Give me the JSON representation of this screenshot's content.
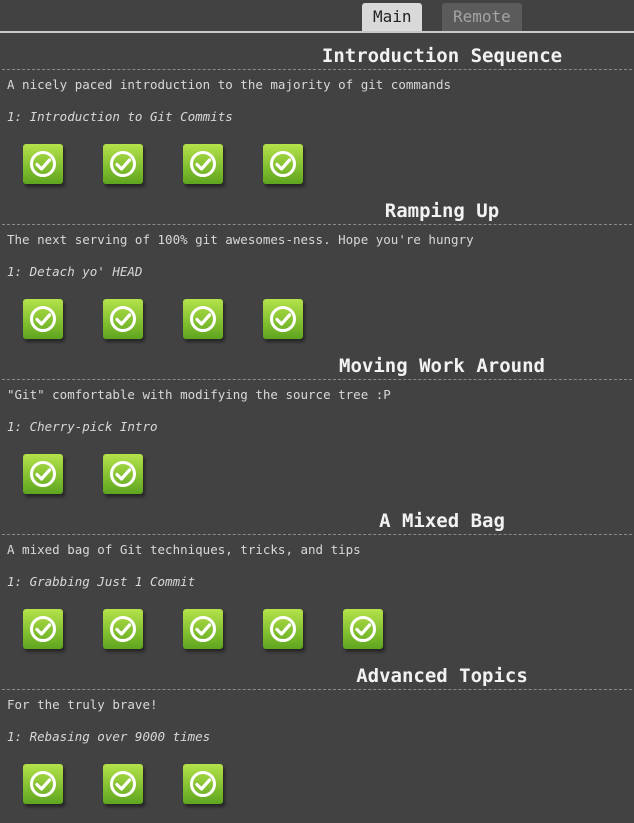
{
  "tabs": [
    {
      "label": "Main",
      "selected": true
    },
    {
      "label": "Remote",
      "selected": false
    }
  ],
  "colors": {
    "background": "#424242",
    "completed_level": "#7ec22e",
    "tab_selected_bg": "#d9d9d9",
    "tab_unselected_bg": "#5b5b5b"
  },
  "sequences": [
    {
      "title": "Introduction Sequence",
      "about": "A nicely paced introduction to the majority of git commands",
      "current_level": "1: Introduction to Git Commits",
      "level_count": 4,
      "completed_icon": "check-circle-icon"
    },
    {
      "title": "Ramping Up",
      "about": "The next serving of 100% git awesomes-ness. Hope you're hungry",
      "current_level": "1: Detach yo' HEAD",
      "level_count": 4,
      "completed_icon": "check-circle-icon"
    },
    {
      "title": "Moving Work Around",
      "about": "\"Git\" comfortable with modifying the source tree :P",
      "current_level": "1: Cherry-pick Intro",
      "level_count": 2,
      "completed_icon": "check-circle-icon"
    },
    {
      "title": "A Mixed Bag",
      "about": "A mixed bag of Git techniques, tricks, and tips",
      "current_level": "1: Grabbing Just 1 Commit",
      "level_count": 5,
      "completed_icon": "check-circle-icon"
    },
    {
      "title": "Advanced Topics",
      "about": "For the truly brave!",
      "current_level": "1: Rebasing over 9000 times",
      "level_count": 3,
      "completed_icon": "check-circle-icon"
    }
  ]
}
